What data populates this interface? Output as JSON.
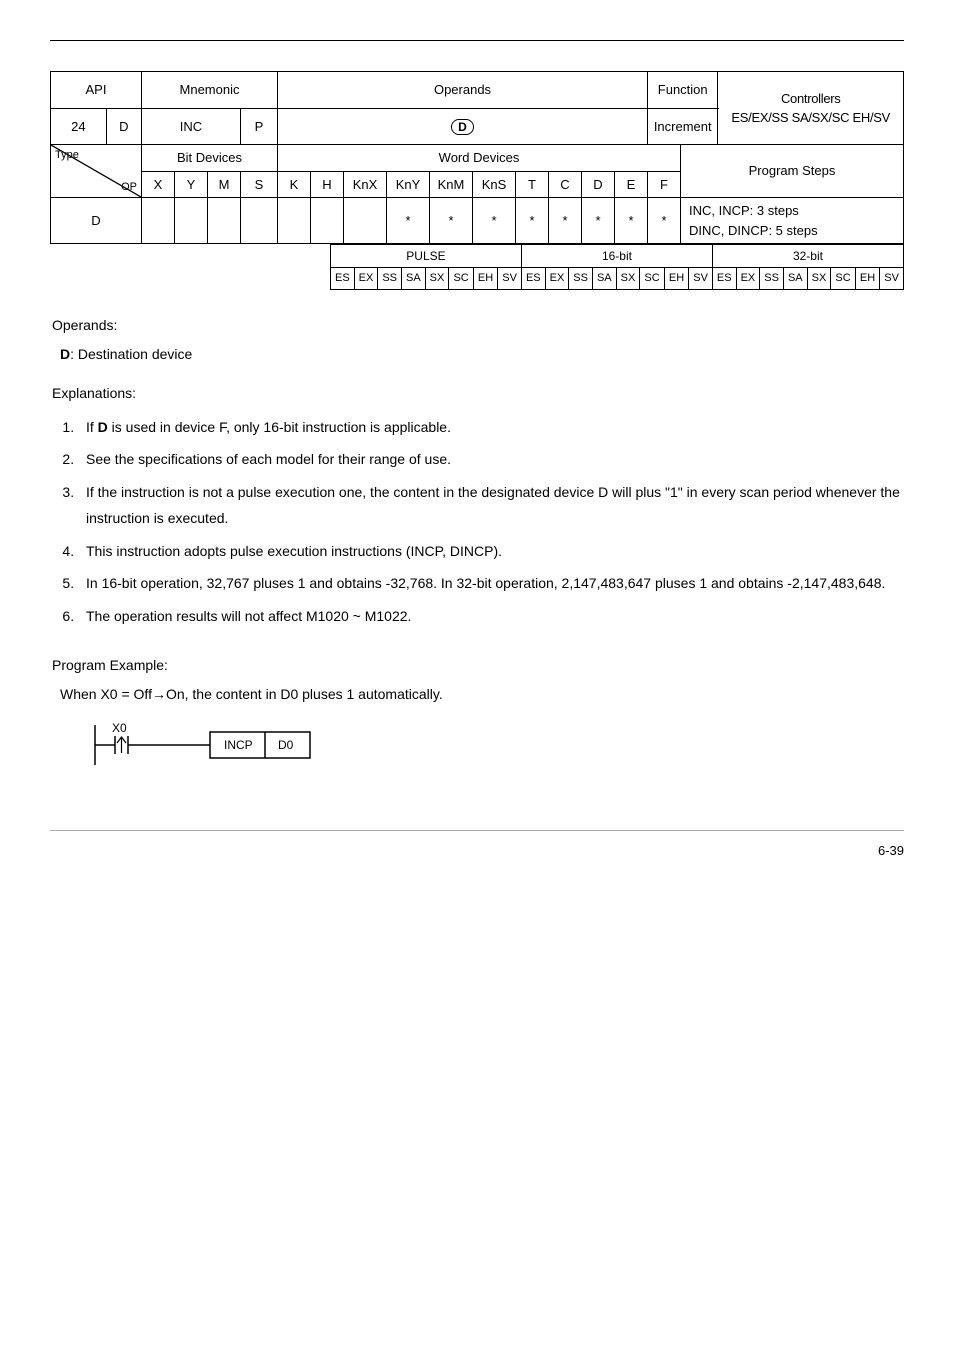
{
  "api": {
    "number": "24",
    "prefix": "D",
    "mnemonic": "INC",
    "suffix": "P",
    "operands_label": "Operands",
    "operand_symbol": "D",
    "function_label": "Function",
    "function_text": "Increment",
    "controllers_label": "Controllers",
    "controllers": [
      "ES/EX/SS",
      "SA/SX/SC",
      "EH/SV"
    ]
  },
  "opTable": {
    "diagonal": {
      "top": "Type",
      "bottom": "OP"
    },
    "bitDevice": "Bit Devices",
    "wordDevice": "Word Devices",
    "programSteps": "Program Steps",
    "cols": [
      "X",
      "Y",
      "M",
      "S",
      "K",
      "H",
      "KnX",
      "KnY",
      "KnM",
      "KnS",
      "T",
      "C",
      "D",
      "E",
      "F"
    ],
    "rowD_label": "D",
    "steps_inc": "INC, INCP: 3 steps",
    "steps_dinc": "DINC, DINCP: 5 steps",
    "star": "*"
  },
  "bitTable": {
    "headers": [
      "PULSE",
      "16-bit",
      "32-bit"
    ],
    "cells": [
      "ES",
      "EX",
      "SS",
      "SA",
      "SX",
      "SC",
      "EH",
      "SV",
      "ES",
      "EX",
      "SS",
      "SA",
      "SX",
      "SC",
      "EH",
      "SV",
      "ES",
      "EX",
      "SS",
      "SA",
      "SX",
      "SC",
      "EH",
      "SV"
    ]
  },
  "operands": {
    "heading": "Operands:",
    "text_label": "D",
    "text": ": Destination device"
  },
  "explanations": {
    "heading": "Explanations:",
    "items": [
      {
        "pre": "If ",
        "bold": "D",
        "post": " is used in device F, only 16-bit instruction is applicable."
      },
      {
        "text": "See the specifications of each model for their range of use."
      },
      {
        "text": "If the instruction is not a pulse execution one, the content in the designated device D will plus \"1\" in every scan period whenever the instruction is executed."
      },
      {
        "text": "This instruction adopts pulse execution instructions (INCP, DINCP)."
      },
      {
        "text": "In 16-bit operation, 32,767 pluses 1 and obtains -32,768. In 32-bit operation, 2,147,483,647 pluses 1 and obtains -2,147,483,648."
      },
      {
        "text": "The operation results will not affect M1020 ~ M1022."
      }
    ]
  },
  "programExample": {
    "heading": "Program Example:",
    "text": "When X0 = Off→On, the content in D0 pluses 1 automatically.",
    "ladder": {
      "contact": "X0",
      "inst": "INCP",
      "arg": "D0"
    }
  },
  "pageNum": "6-39"
}
